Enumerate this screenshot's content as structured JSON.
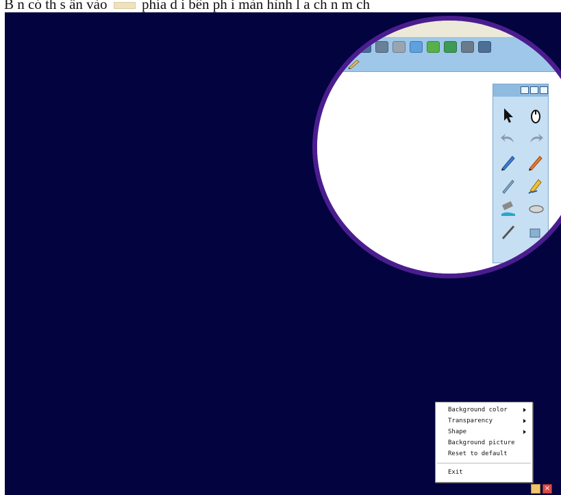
{
  "caption": {
    "part1": "B  n có th   s  ấn vào",
    "part2": "phía d   i bên ph  i màn hình",
    "part3": "  l  a ch  n m ch"
  },
  "context_menu": {
    "items": [
      {
        "label": "Background color",
        "submenu": true
      },
      {
        "label": "Transparency",
        "submenu": true
      },
      {
        "label": "Shape",
        "submenu": true
      },
      {
        "label": "Background picture",
        "submenu": false
      },
      {
        "label": "Reset to default",
        "submenu": false
      }
    ],
    "exit_label": "Exit"
  },
  "tray": {
    "close_glyph": "×"
  },
  "colors": {
    "desktop": "#03033f",
    "magnifier_ring": "#4a1d8f",
    "toolbar": "#9ec7e9"
  }
}
